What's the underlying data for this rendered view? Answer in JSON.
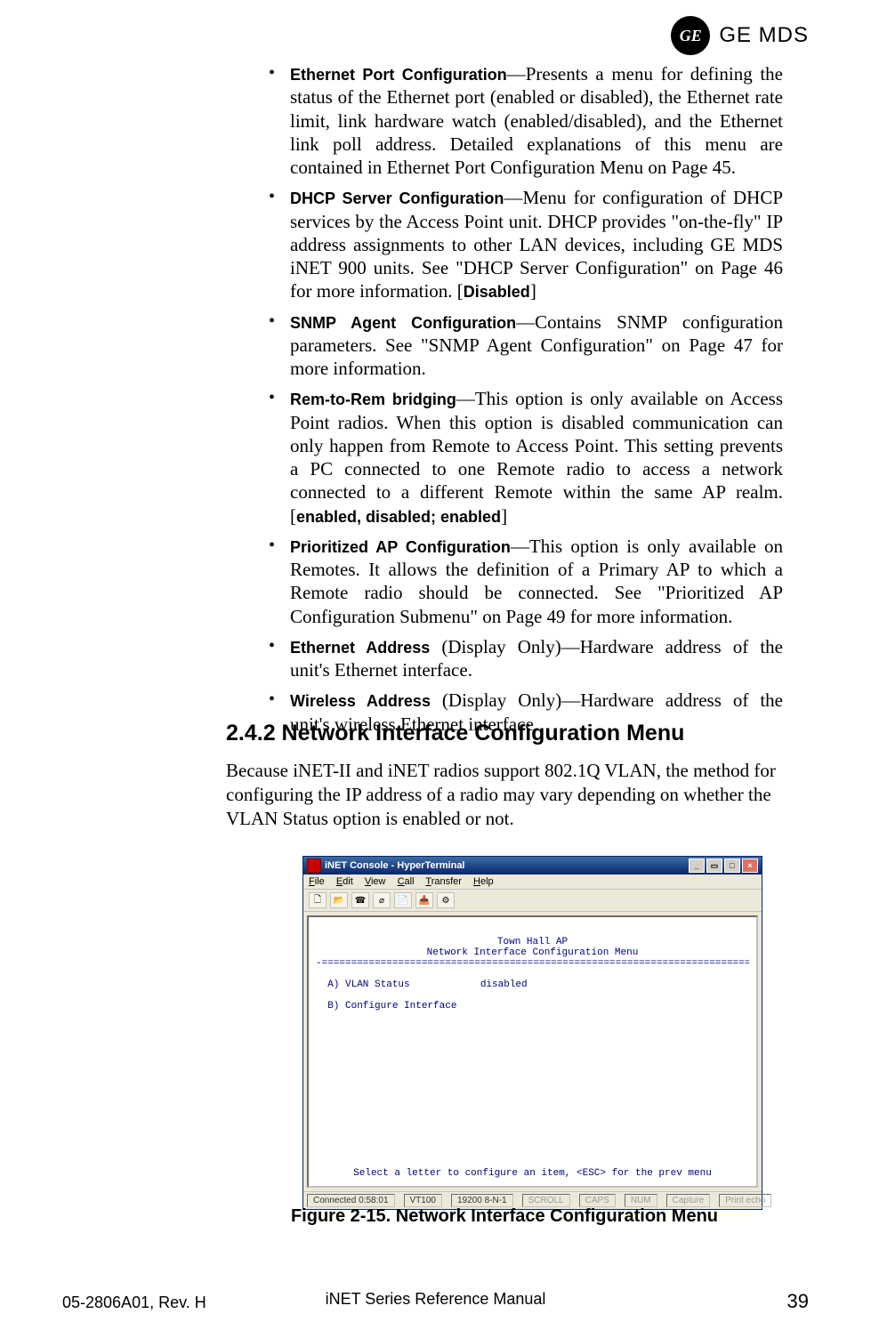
{
  "header": {
    "brand_mono": "GE",
    "brand_text": "GE MDS"
  },
  "bullets": [
    {
      "label": "Ethernet Port Configuration",
      "text": "—Presents a menu for defining the status of the Ethernet port (enabled or disabled), the Ethernet rate limit, link hardware watch (enabled/disabled), and the Ethernet link poll address. Detailed explanations of this menu are contained in Ethernet Port Configuration Menu on Page 45."
    },
    {
      "label": "DHCP Server Configuration",
      "text": "—Menu for configuration of DHCP services by the Access Point unit. DHCP provides \"on-the-fly\" IP address assignments to other LAN devices, including GE MDS iNET 900 units. See \"DHCP Server Configuration\" on Page 46 for more information. [",
      "tail_bold": "Disabled",
      "tail_after": "]"
    },
    {
      "label": "SNMP Agent Configuration",
      "text": "—Contains SNMP configuration parameters. See \"SNMP Agent Configuration\" on Page 47 for more information."
    },
    {
      "label": "Rem-to-Rem bridging",
      "text": "—This option is only available on Access Point radios. When this option is disabled communication can only happen from Remote to Access Point. This setting prevents a PC connected to one Remote radio to access a network connected to a different Remote within the same AP realm. [",
      "tail_bold": "enabled, disabled; enabled",
      "tail_after": "]"
    },
    {
      "label": "Prioritized AP Configuration",
      "text": "—This option is only available on Remotes. It allows the definition of a Primary AP to which a Remote radio should be connected. See \"Prioritized AP Configuration Submenu\" on Page 49 for more information."
    },
    {
      "label": "Ethernet Address",
      "mid_plain": " (Display Only)",
      "text": "—Hardware address of the unit's Ethernet interface."
    },
    {
      "label": "Wireless Address",
      "mid_plain": " (Display Only)",
      "text": "—Hardware address of the unit's wireless Ethernet interface."
    }
  ],
  "section": {
    "heading": "2.4.2 Network Interface Configuration Menu",
    "para": "Because iNET-II and iNET radios support 802.1Q VLAN, the method for configuring the IP address of a radio may vary depending on whether the VLAN Status option is enabled or not."
  },
  "figure": {
    "window_title": "iNET Console - HyperTerminal",
    "menubar": [
      "File",
      "Edit",
      "View",
      "Call",
      "Transfer",
      "Help"
    ],
    "terminal": {
      "line1": "Town Hall AP",
      "line2": "Network Interface Configuration Menu",
      "rule": "-==========================================================================-",
      "rowA": "  A) VLAN Status            disabled",
      "rowB": "  B) Configure Interface",
      "footer": "Select a letter to configure an item, <ESC> for the prev menu"
    },
    "status": {
      "connected": "Connected 0:58:01",
      "emul": "VT100",
      "baud": "19200 8-N-1",
      "scroll": "SCROLL",
      "caps": "CAPS",
      "num": "NUM",
      "capture": "Capture",
      "echo": "Print echo"
    },
    "caption": "Figure 2-15. Network Interface Configuration Menu"
  },
  "footer": {
    "left": "05-2806A01, Rev. H",
    "center": "iNET Series Reference Manual",
    "right": "39"
  }
}
